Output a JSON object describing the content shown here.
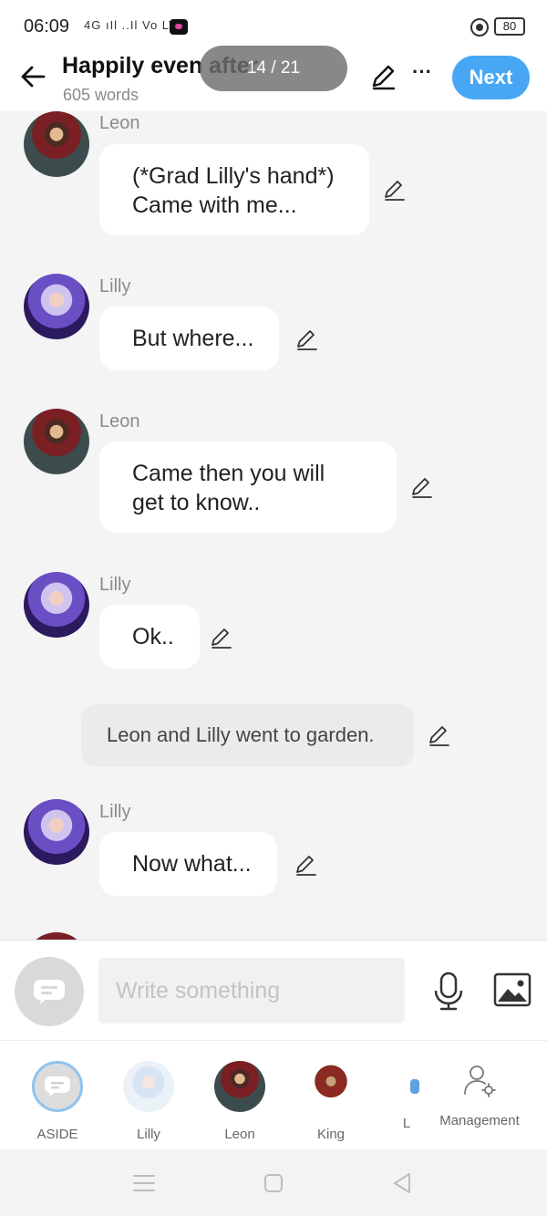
{
  "status_bar": {
    "time": "06:09",
    "signal_text": "4G ıIl ..Il Vo LTE",
    "battery": "80"
  },
  "header": {
    "title": "Happily even after",
    "word_count": "605 words",
    "page_indicator": "14 / 21",
    "more_label": "···",
    "next_label": "Next"
  },
  "messages": [
    {
      "sender": "Leon",
      "text_lines": [
        "(*Grad Lilly's hand*)",
        "Came with me..."
      ]
    },
    {
      "sender": "Lilly",
      "text_lines": [
        "But where..."
      ]
    },
    {
      "sender": "Leon",
      "text_lines": [
        "Came then you will",
        "get to know.."
      ]
    },
    {
      "sender": "Lilly",
      "text_lines": [
        "Ok.."
      ]
    },
    {
      "narration": "Leon and Lilly went to garden."
    },
    {
      "sender": "Lilly",
      "text_lines": [
        "Now what..."
      ]
    }
  ],
  "input": {
    "placeholder": "Write something"
  },
  "characters": [
    {
      "label": "ASIDE"
    },
    {
      "label": "Lilly"
    },
    {
      "label": "Leon"
    },
    {
      "label": "King"
    },
    {
      "label": "L"
    }
  ],
  "management_label": "Management",
  "colors": {
    "accent": "#47a7f5",
    "background": "#f4f4f4",
    "bubble": "#ffffff",
    "narration": "#ebebeb"
  }
}
